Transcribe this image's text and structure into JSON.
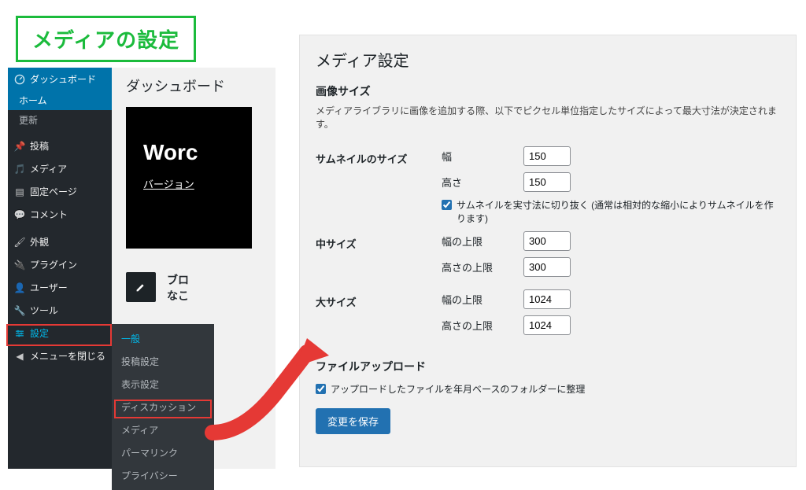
{
  "titleBox": "メディアの設定",
  "sidebar": {
    "dashboard": "ダッシュボード",
    "home": "ホーム",
    "updates": "更新",
    "posts": "投稿",
    "media": "メディア",
    "pages": "固定ページ",
    "comments": "コメント",
    "appearance": "外観",
    "plugins": "プラグイン",
    "users": "ユーザー",
    "tools": "ツール",
    "settings": "設定",
    "collapse": "メニューを閉じる"
  },
  "flyout": {
    "general": "一般",
    "writing": "投稿設定",
    "reading": "表示設定",
    "discussion": "ディスカッション",
    "media": "メディア",
    "permalink": "パーマリンク",
    "privacy": "プライバシー"
  },
  "wpContent": {
    "heading": "ダッシュボード",
    "logo": "Worc",
    "versionLink": "バージョン",
    "blockLine1": "ブロ",
    "blockLine2": "なこ"
  },
  "panel": {
    "title": "メディア設定",
    "sectionImage": "画像サイズ",
    "imageDesc": "メディアライブラリに画像を追加する際、以下でピクセル単位指定したサイズによって最大寸法が決定されます。",
    "thumbLabel": "サムネイルのサイズ",
    "widthLabel": "幅",
    "heightLabel": "高さ",
    "thumbW": "150",
    "thumbH": "150",
    "thumbCrop": "サムネイルを実寸法に切り抜く (通常は相対的な縮小によりサムネイルを作ります)",
    "mediumLabel": "中サイズ",
    "maxWidthLabel": "幅の上限",
    "maxHeightLabel": "高さの上限",
    "mediumW": "300",
    "mediumH": "300",
    "largeLabel": "大サイズ",
    "largeW": "1024",
    "largeH": "1024",
    "sectionUpload": "ファイルアップロード",
    "uploadOrg": "アップロードしたファイルを年月ベースのフォルダーに整理",
    "save": "変更を保存"
  }
}
